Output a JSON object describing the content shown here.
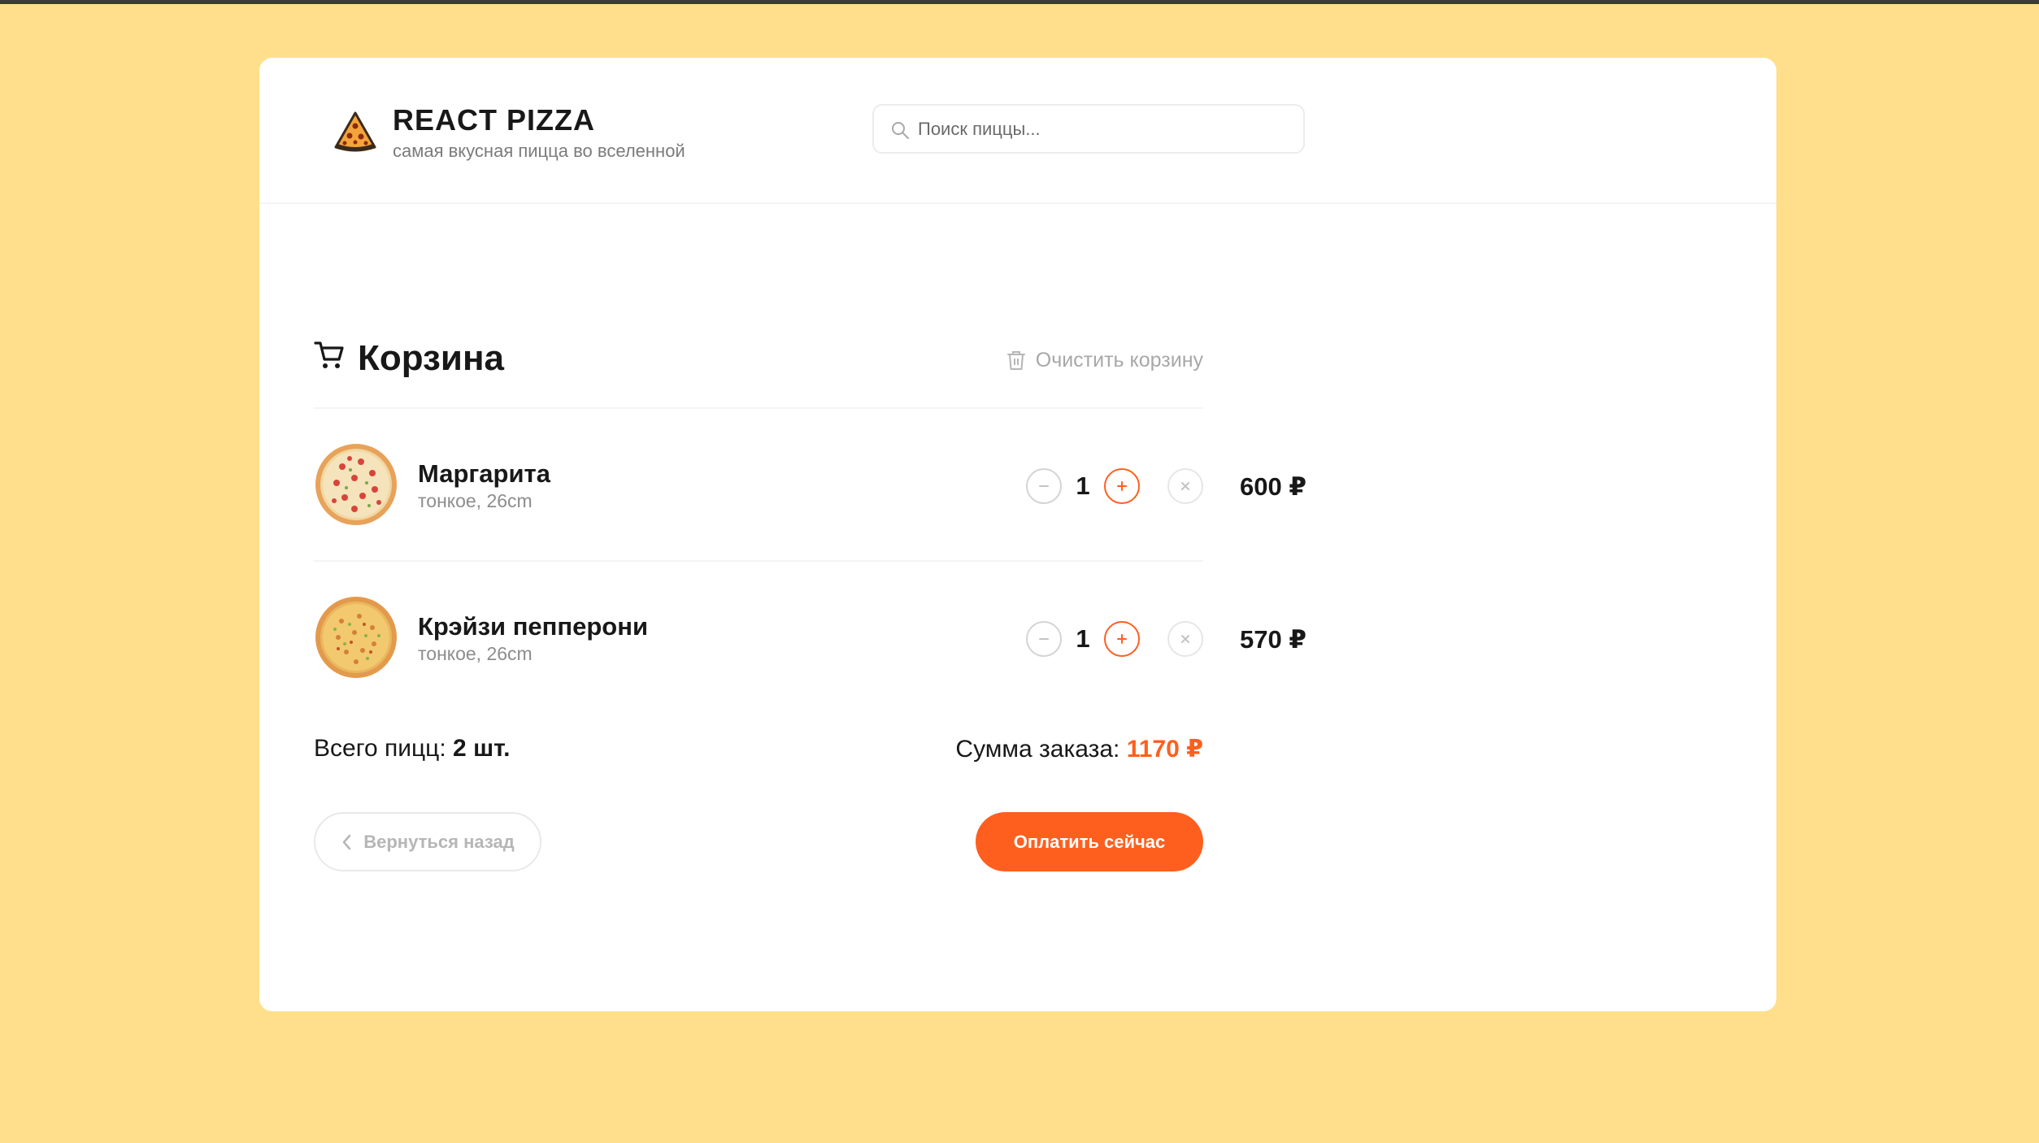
{
  "header": {
    "title": "REACT PIZZA",
    "subtitle": "самая вкусная пицца во вселенной",
    "logo_icon": "pizza-slice-icon"
  },
  "search": {
    "placeholder": "Поиск пиццы...",
    "value": "",
    "icon": "search-icon"
  },
  "cart": {
    "title": "Корзина",
    "icon": "cart-icon",
    "clear_label": "Очистить корзину",
    "clear_icon": "trash-icon",
    "items": [
      {
        "name": "Маргарита",
        "desc": "тонкое, 26cm",
        "qty": "1",
        "price": "600 ₽"
      },
      {
        "name": "Крэйзи пепперони",
        "desc": "тонкое, 26cm",
        "qty": "1",
        "price": "570 ₽"
      }
    ],
    "total_count_label": "Всего пицц:",
    "total_count_value": "2 шт.",
    "total_sum_label": "Сумма заказа:",
    "total_sum_value": "1170 ₽",
    "back_label": "Вернуться назад",
    "pay_label": "Оплатить сейчас"
  },
  "colors": {
    "background": "#FFDF8C",
    "accent": "#FE5F1E",
    "text": "#181818",
    "muted": "#B6B6B6"
  }
}
